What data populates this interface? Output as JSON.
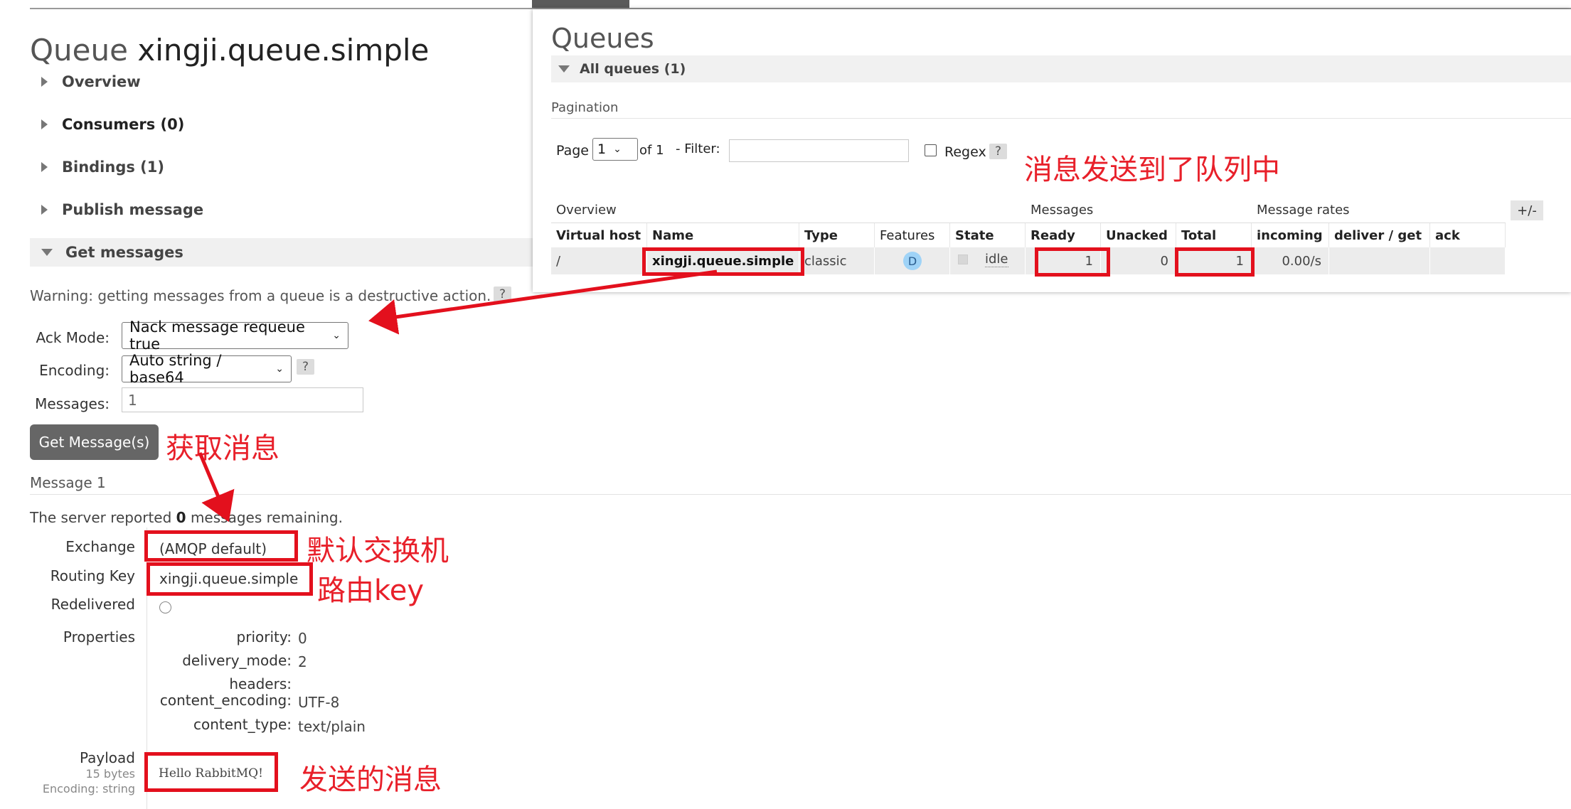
{
  "page": {
    "title_prefix": "Queue",
    "queue_name": "xingji.queue.simple",
    "sections": [
      {
        "label": "Overview"
      },
      {
        "label": "Consumers (0)"
      },
      {
        "label": "Bindings (1)"
      },
      {
        "label": "Publish message"
      },
      {
        "label": "Get messages"
      }
    ]
  },
  "get_messages": {
    "warning": "Warning: getting messages from a queue is a destructive action.",
    "help": "?",
    "ack_mode_label": "Ack Mode:",
    "ack_mode_value": "Nack message requeue true",
    "encoding_label": "Encoding:",
    "encoding_value": "Auto string / base64",
    "messages_label": "Messages:",
    "messages_value": "1",
    "button": "Get Message(s)"
  },
  "message": {
    "heading": "Message 1",
    "reported_prefix": "The server reported",
    "reported_count": "0",
    "reported_suffix": "messages remaining.",
    "exchange_label": "Exchange",
    "exchange_value": "(AMQP default)",
    "routing_key_label": "Routing Key",
    "routing_key_value": "xingji.queue.simple",
    "redelivered_label": "Redelivered",
    "redelivered_checked": false,
    "properties_label": "Properties",
    "properties": [
      {
        "key": "priority:",
        "value": "0"
      },
      {
        "key": "delivery_mode:",
        "value": "2"
      },
      {
        "key": "headers:",
        "value": ""
      },
      {
        "key": "content_encoding:",
        "value": "UTF-8"
      },
      {
        "key": "content_type:",
        "value": "text/plain"
      }
    ],
    "payload_label": "Payload",
    "payload_bytes": "15 bytes",
    "payload_encoding": "Encoding: string",
    "payload_value": "Hello RabbitMQ!"
  },
  "queues_panel": {
    "title": "Queues",
    "all_queues": "All queues (1)",
    "pagination_label": "Pagination",
    "page_label": "Page",
    "page_value": "1",
    "of_label": "of 1",
    "filter_label": "- Filter:",
    "filter_value": "",
    "regex_label": "Regex",
    "regex_help": "?",
    "plus_minus": "+/-",
    "groups": [
      "Overview",
      "Messages",
      "Message rates"
    ],
    "columns": [
      "Virtual host",
      "Name",
      "Type",
      "Features",
      "State",
      "Ready",
      "Unacked",
      "Total",
      "incoming",
      "deliver / get",
      "ack"
    ],
    "row": {
      "virtual_host": "/",
      "name": "xingji.queue.simple",
      "type": "classic",
      "feature": "D",
      "state": "idle",
      "ready": "1",
      "unacked": "0",
      "total": "1",
      "incoming": "0.00/s",
      "deliver_get": "",
      "ack": ""
    }
  },
  "annotations": {
    "sent_to_queue": "消息发送到了队列中",
    "get_message": "获取消息",
    "default_exchange": "默认交换机",
    "routing_key": "路由key",
    "sent_message": "发送的消息"
  },
  "colors": {
    "annotation_red": "#e3101d",
    "button_gray": "#666666",
    "feature_badge": "#9fd3f7"
  }
}
